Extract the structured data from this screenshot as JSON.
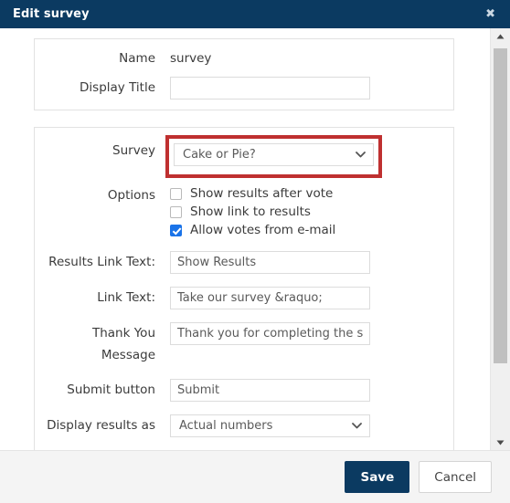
{
  "header": {
    "title": "Edit survey",
    "close_label": "✖"
  },
  "panel_one": {
    "rows": [
      {
        "label": "Name",
        "value": "survey"
      },
      {
        "label": "Display Title",
        "value": "",
        "placeholder": ""
      }
    ]
  },
  "panel_two": {
    "survey": {
      "label": "Survey",
      "selected": "Cake or Pie?",
      "highlight_color": "#bf3030"
    },
    "options": {
      "label": "Options",
      "items": [
        {
          "label": "Show results after vote",
          "checked": false
        },
        {
          "label": "Show link to results",
          "checked": false
        },
        {
          "label": "Allow votes from e-mail",
          "checked": true
        }
      ]
    },
    "results_link_text": {
      "label": "Results Link Text:",
      "value": "Show Results"
    },
    "link_text": {
      "label": "Link Text:",
      "value": "Take our survey &raquo;"
    },
    "thank_you_message": {
      "label": "Thank You Message",
      "value": "Thank you for completing the su"
    },
    "submit_button": {
      "label": "Submit button",
      "value": "Submit"
    },
    "display_results_as": {
      "label": "Display results as",
      "selected": "Actual numbers"
    }
  },
  "footer": {
    "save_label": "Save",
    "cancel_label": "Cancel"
  }
}
